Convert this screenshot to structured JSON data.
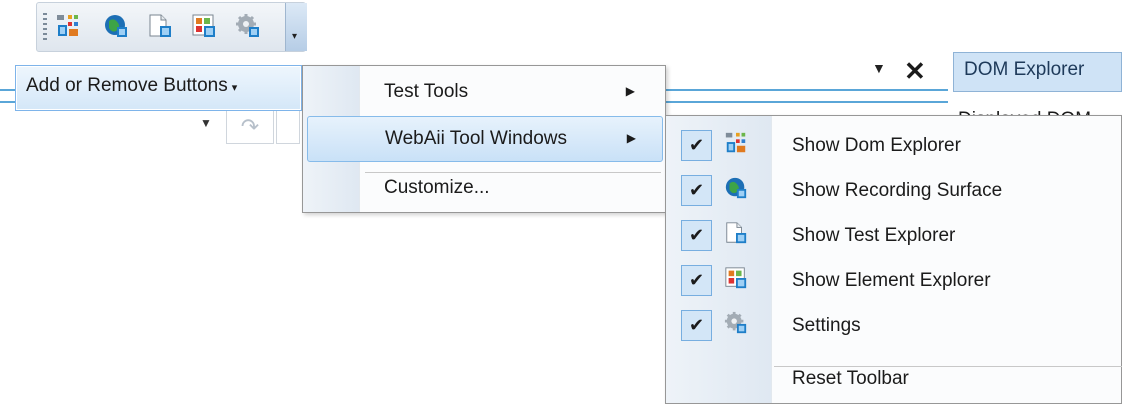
{
  "toolbar": {
    "icons": [
      "dom-explorer-icon",
      "recording-surface-icon",
      "test-explorer-icon",
      "element-explorer-icon",
      "settings-gear-icon"
    ],
    "overflow_glyph": "▾"
  },
  "background": {
    "tab_label": "DOM Explorer",
    "displayed_dom_label": "Displayed DOM",
    "pin_glyph": "▼",
    "close_glyph": "✕",
    "redo_glyph": "↷"
  },
  "add_remove": {
    "label": "Add or Remove Buttons",
    "arrow": "▾"
  },
  "menu1": {
    "items": [
      {
        "label": "Test Tools",
        "submenu": "▶"
      },
      {
        "label": "WebAii Tool Windows",
        "submenu": "▶"
      },
      {
        "label": "Customize..."
      }
    ]
  },
  "menu2": {
    "items": [
      {
        "label": "Show Dom Explorer",
        "checked": "✔",
        "icon": "dom-explorer-icon"
      },
      {
        "label": "Show Recording Surface",
        "checked": "✔",
        "icon": "recording-surface-icon"
      },
      {
        "label": "Show Test Explorer",
        "checked": "✔",
        "icon": "test-explorer-icon"
      },
      {
        "label": "Show Element Explorer",
        "checked": "✔",
        "icon": "element-explorer-icon"
      },
      {
        "label": "Settings",
        "checked": "✔",
        "icon": "settings-gear-icon"
      },
      {
        "label": "Reset Toolbar"
      }
    ]
  },
  "colors": {
    "highlight": "#c9e1f7",
    "highlight_border": "#86bbea",
    "check_bg": "#d3e6f7"
  }
}
